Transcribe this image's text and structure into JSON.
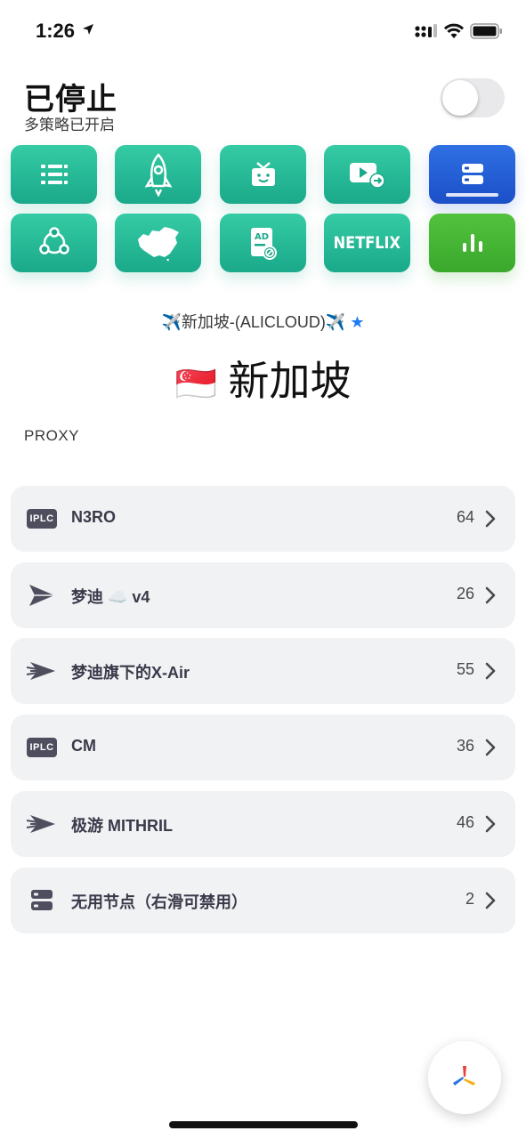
{
  "status_bar": {
    "time": "1:26"
  },
  "header": {
    "title": "已停止",
    "subtitle": "多策略已开启"
  },
  "tiles": [
    {
      "name": "list-icon"
    },
    {
      "name": "rocket-icon"
    },
    {
      "name": "tv-gift-icon"
    },
    {
      "name": "video-play-icon"
    },
    {
      "name": "server-icon"
    },
    {
      "name": "network-icon"
    },
    {
      "name": "china-map-icon"
    },
    {
      "name": "ad-block-icon"
    },
    {
      "name": "netflix-icon",
      "text": "NETFLIX"
    },
    {
      "name": "stats-icon"
    }
  ],
  "current_node": {
    "line": "✈️新加坡-(ALICLOUD)✈️",
    "star": "★",
    "flag": "🇸🇬",
    "name": "新加坡"
  },
  "section_label": "PROXY",
  "proxy_groups": [
    {
      "icon": "iplc-icon",
      "icon_text": "IPLC",
      "label": "N3RO",
      "count": "64"
    },
    {
      "icon": "paper-plane-icon",
      "label": "梦迪 ☁️ v4",
      "count": "26"
    },
    {
      "icon": "speed-plane-icon",
      "label": "梦迪旗下的X-Air",
      "count": "55"
    },
    {
      "icon": "iplc-icon",
      "icon_text": "IPLC",
      "label": "CM",
      "count": "36"
    },
    {
      "icon": "speed-plane-icon",
      "label": "极游 MITHRIL",
      "count": "46"
    },
    {
      "icon": "server-icon",
      "label": "无用节点（右滑可禁用）",
      "count": "2"
    }
  ],
  "colors": {
    "teal": "#1aa98a",
    "blue": "#1b4fc7",
    "green": "#3aa82c",
    "star": "#1e7cf2"
  }
}
